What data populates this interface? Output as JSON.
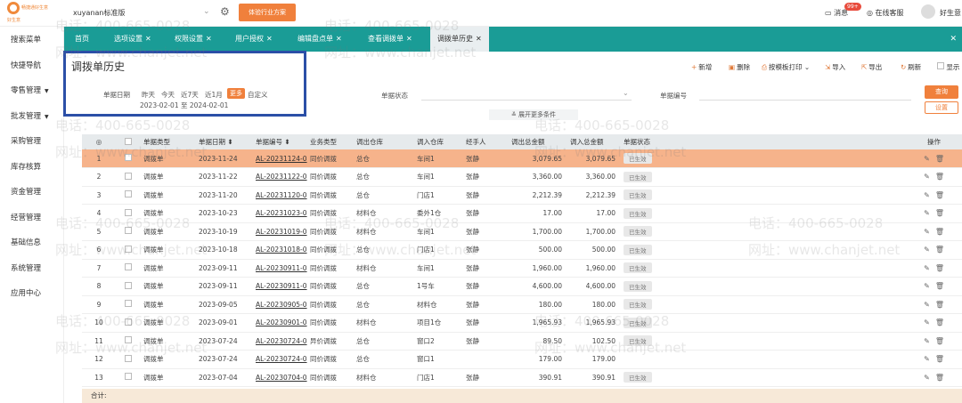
{
  "topbar": {
    "logo_text": "畅捷通好生意",
    "logo_sub": "好生意",
    "account": "xuyanan标准版",
    "trial_button": "体验行业方案",
    "messages_label": "消息",
    "messages_badge": "99+",
    "support_label": "在线客服",
    "user_label": "好生意"
  },
  "sidebar": {
    "items": [
      {
        "label": "搜索菜单",
        "has_arrow": false
      },
      {
        "label": "快捷导航",
        "has_arrow": false
      },
      {
        "label": "零售管理",
        "has_arrow": true
      },
      {
        "label": "批发管理",
        "has_arrow": true
      },
      {
        "label": "采购管理",
        "has_arrow": false
      },
      {
        "label": "库存核算",
        "has_arrow": false
      },
      {
        "label": "资金管理",
        "has_arrow": false
      },
      {
        "label": "经营管理",
        "has_arrow": false
      },
      {
        "label": "基础信息",
        "has_arrow": false
      },
      {
        "label": "系统管理",
        "has_arrow": false
      },
      {
        "label": "应用中心",
        "has_arrow": false
      }
    ]
  },
  "tabs": [
    {
      "label": "首页",
      "closable": false,
      "active": false
    },
    {
      "label": "选项设置",
      "closable": true,
      "active": false
    },
    {
      "label": "权限设置",
      "closable": true,
      "active": false
    },
    {
      "label": "用户授权",
      "closable": true,
      "active": false
    },
    {
      "label": "编辑盘点单",
      "closable": true,
      "active": false
    },
    {
      "label": "查看调拨单",
      "closable": true,
      "active": false
    },
    {
      "label": "调拨单历史",
      "closable": true,
      "active": true
    }
  ],
  "page": {
    "title": "调拨单历史"
  },
  "toolbar": {
    "new": "新增",
    "delete": "删除",
    "print_template": "按模板打印",
    "import": "导入",
    "export": "导出",
    "refresh": "刷新",
    "show": "显示"
  },
  "filters": {
    "date_label": "单据日期",
    "date_options": [
      "昨天",
      "今天",
      "近7天",
      "近1月",
      "更多",
      "自定义"
    ],
    "date_range": "2023-02-01 至 2024-02-01",
    "status_label": "单据状态",
    "docno_label": "单据编号",
    "query_button": "查询",
    "settings_button": "设置",
    "expand_label": "展开更多条件"
  },
  "table": {
    "columns": [
      "",
      "",
      "单据类型",
      "单据日期",
      "单据编号",
      "业务类型",
      "调出仓库",
      "调入仓库",
      "经手人",
      "调出总金额",
      "调入总金额",
      "单据状态",
      "操作"
    ],
    "rows": [
      {
        "no": "1",
        "type": "调拨单",
        "date": "2023-11-24",
        "code": "AL-20231124-0",
        "biz": "同价调拨",
        "out": "总仓",
        "in": "车间1",
        "handler": "张静",
        "out_amt": "3,079.65",
        "in_amt": "3,079.65",
        "status": "已生效",
        "selected": true
      },
      {
        "no": "2",
        "type": "调拨单",
        "date": "2023-11-22",
        "code": "AL-20231122-0",
        "biz": "同价调拨",
        "out": "总仓",
        "in": "车间1",
        "handler": "张静",
        "out_amt": "3,360.00",
        "in_amt": "3,360.00",
        "status": "已生效",
        "selected": false
      },
      {
        "no": "3",
        "type": "调拨单",
        "date": "2023-11-20",
        "code": "AL-20231120-0",
        "biz": "同价调拨",
        "out": "总仓",
        "in": "门店1",
        "handler": "张静",
        "out_amt": "2,212.39",
        "in_amt": "2,212.39",
        "status": "已生效",
        "selected": false
      },
      {
        "no": "4",
        "type": "调拨单",
        "date": "2023-10-23",
        "code": "AL-20231023-0",
        "biz": "同价调拨",
        "out": "材料仓",
        "in": "委外1仓",
        "handler": "张静",
        "out_amt": "17.00",
        "in_amt": "17.00",
        "status": "已生效",
        "selected": false
      },
      {
        "no": "5",
        "type": "调拨单",
        "date": "2023-10-19",
        "code": "AL-20231019-0",
        "biz": "同价调拨",
        "out": "材料仓",
        "in": "车间1",
        "handler": "张静",
        "out_amt": "1,700.00",
        "in_amt": "1,700.00",
        "status": "已生效",
        "selected": false
      },
      {
        "no": "6",
        "type": "调拨单",
        "date": "2023-10-18",
        "code": "AL-20231018-0",
        "biz": "同价调拨",
        "out": "总仓",
        "in": "门店1",
        "handler": "张静",
        "out_amt": "500.00",
        "in_amt": "500.00",
        "status": "已生效",
        "selected": false
      },
      {
        "no": "7",
        "type": "调拨单",
        "date": "2023-09-11",
        "code": "AL-20230911-0",
        "biz": "同价调拨",
        "out": "材料仓",
        "in": "车间1",
        "handler": "张静",
        "out_amt": "1,960.00",
        "in_amt": "1,960.00",
        "status": "已生效",
        "selected": false
      },
      {
        "no": "8",
        "type": "调拨单",
        "date": "2023-09-11",
        "code": "AL-20230911-0",
        "biz": "同价调拨",
        "out": "总仓",
        "in": "1号车",
        "handler": "张静",
        "out_amt": "4,600.00",
        "in_amt": "4,600.00",
        "status": "已生效",
        "selected": false
      },
      {
        "no": "9",
        "type": "调拨单",
        "date": "2023-09-05",
        "code": "AL-20230905-0",
        "biz": "同价调拨",
        "out": "总仓",
        "in": "材料仓",
        "handler": "张静",
        "out_amt": "180.00",
        "in_amt": "180.00",
        "status": "已生效",
        "selected": false
      },
      {
        "no": "10",
        "type": "调拨单",
        "date": "2023-09-01",
        "code": "AL-20230901-0",
        "biz": "同价调拨",
        "out": "材料仓",
        "in": "项目1仓",
        "handler": "张静",
        "out_amt": "1,965.93",
        "in_amt": "1,965.93",
        "status": "已生效",
        "selected": false
      },
      {
        "no": "11",
        "type": "调拨单",
        "date": "2023-07-24",
        "code": "AL-20230724-0",
        "biz": "异价调拨",
        "out": "总仓",
        "in": "窗口2",
        "handler": "张静",
        "out_amt": "89.50",
        "in_amt": "102.50",
        "status": "已生效",
        "selected": false
      },
      {
        "no": "12",
        "type": "调拨单",
        "date": "2023-07-24",
        "code": "AL-20230724-0",
        "biz": "同价调拨",
        "out": "总仓",
        "in": "窗口1",
        "handler": "",
        "out_amt": "179.00",
        "in_amt": "179.00",
        "status": "",
        "selected": false
      },
      {
        "no": "13",
        "type": "调拨单",
        "date": "2023-07-04",
        "code": "AL-20230704-0",
        "biz": "同价调拨",
        "out": "材料仓",
        "in": "门店1",
        "handler": "张静",
        "out_amt": "390.91",
        "in_amt": "390.91",
        "status": "已生效",
        "selected": false
      }
    ],
    "total_label": "合计:"
  },
  "watermarks": [
    "电话：400-665-0028",
    "网址：www.chanjet.net"
  ],
  "colors": {
    "teal": "#1a9c96",
    "orange": "#f0803c",
    "highlight": "#2b4fa7",
    "selected_row": "#f6b38b"
  }
}
